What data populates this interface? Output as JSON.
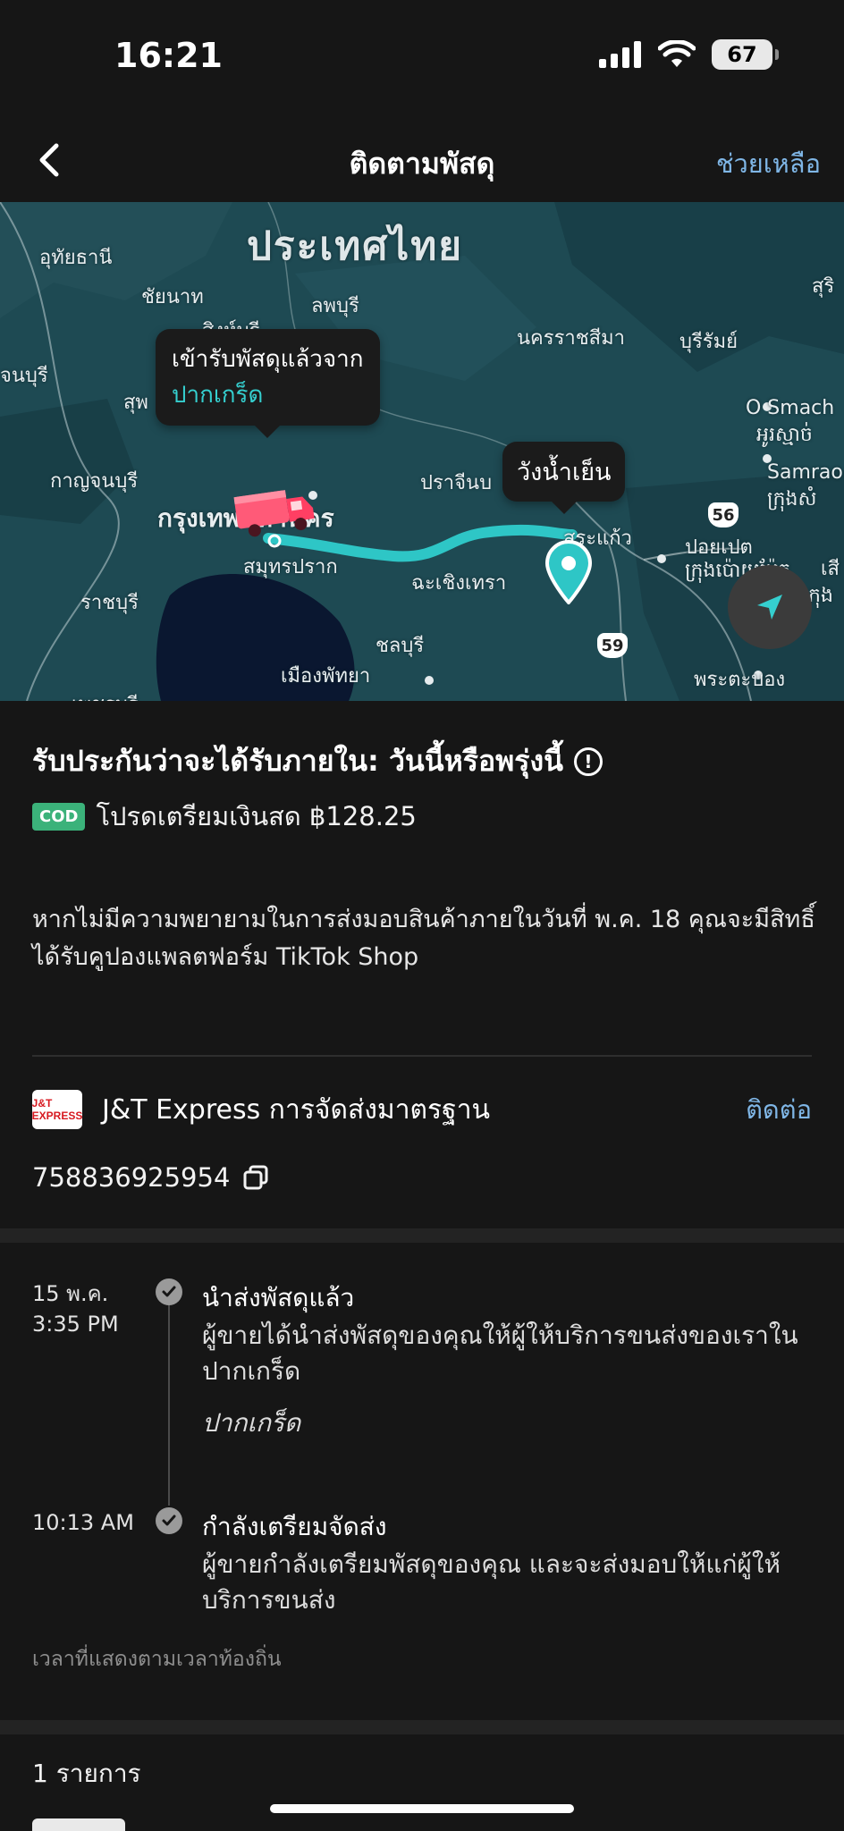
{
  "status_bar": {
    "time": "16:21",
    "battery": "67"
  },
  "nav": {
    "title": "ติดตามพัสดุ",
    "help_label": "ช่วยเหลือ"
  },
  "map": {
    "country_label": "ประเทศไทย",
    "places": {
      "uthai": "อุทัยธานี",
      "chainat": "ชัยนาท",
      "lopburi": "ลพบุรี",
      "singburi": "สิงห์บุรี",
      "suphan": "จนบุรี",
      "su": "สุพ",
      "korat": "นครราชสีมา",
      "buriram": "บุรีรัมย์",
      "kanchanaburi": "กาญจนบุรี",
      "prachin": "ปราจีนบ",
      "bangkok": "กรุงเทพมหานคร",
      "samutprakan": "สมุทรปราก",
      "chachoengsao": "ฉะเชิงเทรา",
      "ratchaburi": "ราชบุรี",
      "chonburi": "ชลบุรี",
      "pattaya": "เมืองพัทยา",
      "phetchaburi": "เพชรบุรี",
      "sakaeo": "สระแก้ว",
      "poipet": "ปอยเปต",
      "poipet_kh": "ក្រុងប៉ោយប៉ែត",
      "osmach": "O Smach",
      "osmach_kh": "អូរស្មាច់",
      "samraong": "Samrao",
      "samraong_kh": "ក្រុងសំ",
      "surin": "สุริ",
      "phra": "พระตะบอง",
      "se": "เสี",
      "kh": "កុង",
      "road56": "56",
      "road59": "59"
    },
    "origin_bubble": {
      "line1": "เข้ารับพัสดุแล้วจาก",
      "line2": "ปากเกร็ด"
    },
    "dest_bubble": "วังน้ำเย็น",
    "colors": {
      "route": "#2ec6c6",
      "truck": "#ff5a78"
    }
  },
  "delivery": {
    "guarantee": "รับประกันว่าจะได้รับภายใน: วันนี้หรือพรุ่งนี้",
    "cod_badge": "COD",
    "cod_text": "โปรดเตรียมเงินสด ฿128.25",
    "notice": "หากไม่มีความพยายามในการส่งมอบสินค้าภายในวันที่ พ.ค. 18 คุณจะมีสิทธิ์ได้รับคูปองแพลตฟอร์ม TikTok Shop"
  },
  "carrier": {
    "logo_text": "J&T EXPRESS",
    "name": "J&T Express การจัดส่งมาตรฐาน",
    "contact_label": "ติดต่อ",
    "tracking_number": "758836925954"
  },
  "timeline": {
    "events": [
      {
        "date": "15 พ.ค.",
        "time": "3:35 PM",
        "title": "นำส่งพัสดุแล้ว",
        "desc": "ผู้ขายได้นำส่งพัสดุของคุณให้ผู้ให้บริการขนส่งของเราใน ปากเกร็ด",
        "location": "ปากเกร็ด"
      },
      {
        "time": "10:13 AM",
        "title": "กำลังเตรียมจัดส่ง",
        "desc": "ผู้ขายกำลังเตรียมพัสดุของคุณ และจะส่งมอบให้แก่ผู้ให้บริการขนส่ง"
      }
    ],
    "local_note": "เวลาที่แสดงตามเวลาท้องถิ่น"
  },
  "items": {
    "count_label": "1 รายการ"
  }
}
